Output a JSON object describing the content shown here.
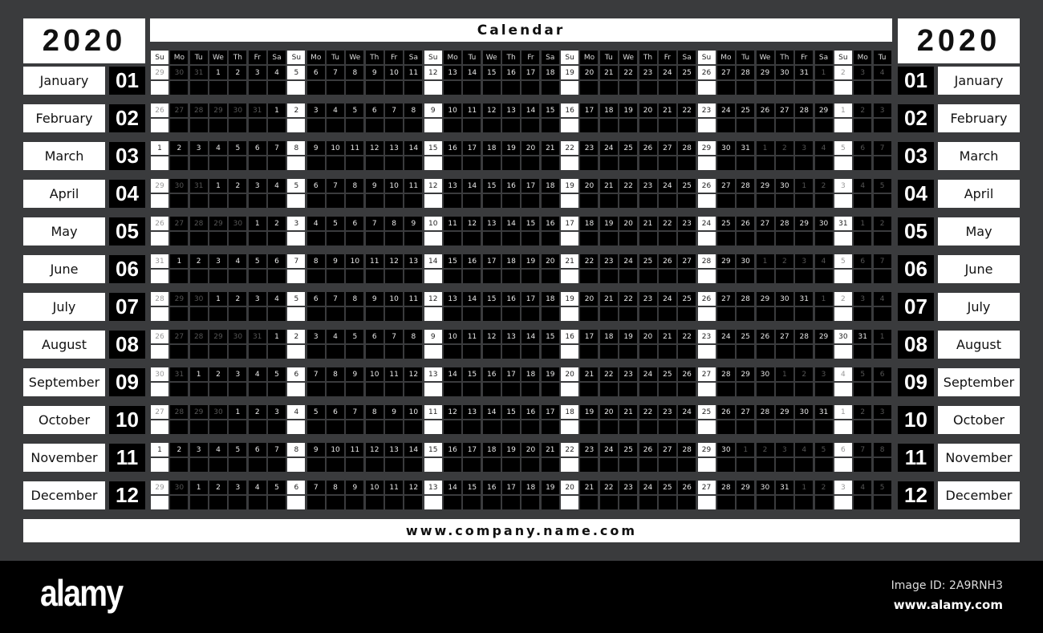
{
  "year": "2020",
  "title": "Calendar",
  "footer_url": "www.company.name.com",
  "weekday_headers": [
    "Su",
    "Mo",
    "Tu",
    "We",
    "Th",
    "Fr",
    "Sa",
    "Su",
    "Mo",
    "Tu",
    "We",
    "Th",
    "Fr",
    "Sa",
    "Su",
    "Mo",
    "Tu",
    "We",
    "Th",
    "Fr",
    "Sa",
    "Su",
    "Mo",
    "Tu",
    "We",
    "Th",
    "Fr",
    "Sa",
    "Su",
    "Mo",
    "Tu",
    "We",
    "Th",
    "Fr",
    "Sa",
    "Su",
    "Mo",
    "Tu"
  ],
  "months": [
    {
      "name": "January",
      "num": "01",
      "prev_days": [
        29,
        30,
        31
      ],
      "days_in_month": 31,
      "next_days": [
        1,
        2,
        3,
        4
      ]
    },
    {
      "name": "February",
      "num": "02",
      "prev_days": [
        26,
        27,
        28,
        29,
        30,
        31
      ],
      "days_in_month": 29,
      "next_days": [
        1,
        2,
        3
      ]
    },
    {
      "name": "March",
      "num": "03",
      "prev_days": [],
      "days_in_month": 31,
      "next_days": [
        1,
        2,
        3,
        4,
        5,
        6,
        7
      ]
    },
    {
      "name": "April",
      "num": "04",
      "prev_days": [
        29,
        30,
        31
      ],
      "days_in_month": 30,
      "next_days": [
        1,
        2,
        3,
        4,
        5
      ]
    },
    {
      "name": "May",
      "num": "05",
      "prev_days": [
        26,
        27,
        28,
        29,
        30
      ],
      "days_in_month": 31,
      "next_days": [
        1,
        2
      ]
    },
    {
      "name": "June",
      "num": "06",
      "prev_days": [
        31
      ],
      "days_in_month": 30,
      "next_days": [
        1,
        2,
        3,
        4,
        5,
        6,
        7
      ]
    },
    {
      "name": "July",
      "num": "07",
      "prev_days": [
        28,
        29,
        30
      ],
      "days_in_month": 31,
      "next_days": [
        1,
        2,
        3,
        4
      ]
    },
    {
      "name": "August",
      "num": "08",
      "prev_days": [
        26,
        27,
        28,
        29,
        30,
        31
      ],
      "days_in_month": 31,
      "next_days": [
        1
      ]
    },
    {
      "name": "September",
      "num": "09",
      "prev_days": [
        30,
        31
      ],
      "days_in_month": 30,
      "next_days": [
        1,
        2,
        3,
        4,
        5,
        6
      ]
    },
    {
      "name": "October",
      "num": "10",
      "prev_days": [
        27,
        28,
        29,
        30
      ],
      "days_in_month": 31,
      "next_days": [
        1,
        2,
        3
      ]
    },
    {
      "name": "November",
      "num": "11",
      "prev_days": [],
      "days_in_month": 30,
      "next_days": [
        1,
        2,
        3,
        4,
        5,
        6,
        7,
        8
      ]
    },
    {
      "name": "December",
      "num": "12",
      "prev_days": [
        29,
        30
      ],
      "days_in_month": 31,
      "next_days": [
        1,
        2,
        3,
        4,
        5
      ]
    }
  ],
  "watermark": {
    "logo": "alamy",
    "image_id": "Image ID: 2A9RNH3",
    "url": "www.alamy.com"
  },
  "colors": {
    "background": "#3a3b3d",
    "cell": "#000000",
    "sunday": "#ffffff",
    "text_dark": "#111111"
  }
}
